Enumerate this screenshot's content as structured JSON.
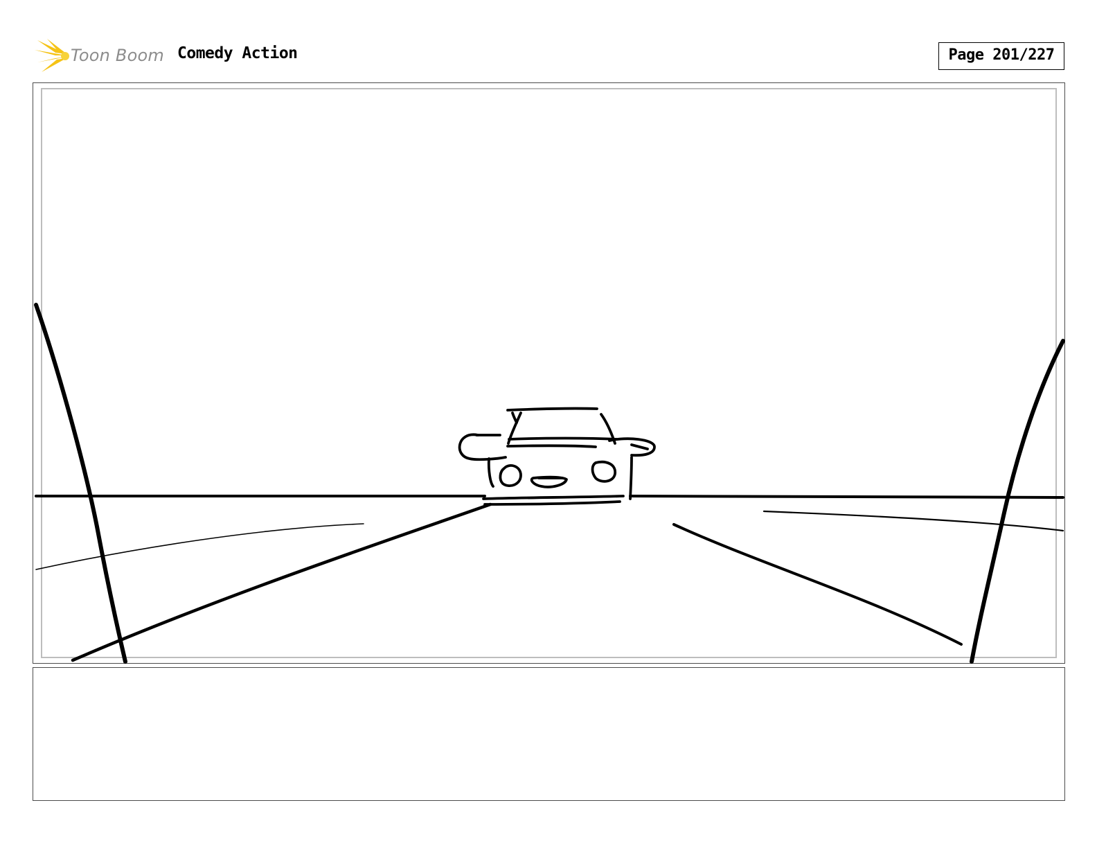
{
  "header": {
    "logo_text": "Toon Boom",
    "project_title": "Comedy Action",
    "page_label": "Page 201/227"
  },
  "colors": {
    "logo_burst": "#f5c316",
    "logo_text": "#8c8c8c",
    "frame_border": "#4a4a4a",
    "inner_border": "#bdbdbd",
    "sketch_ink": "#000000"
  },
  "panel": {
    "caption_text": ""
  }
}
